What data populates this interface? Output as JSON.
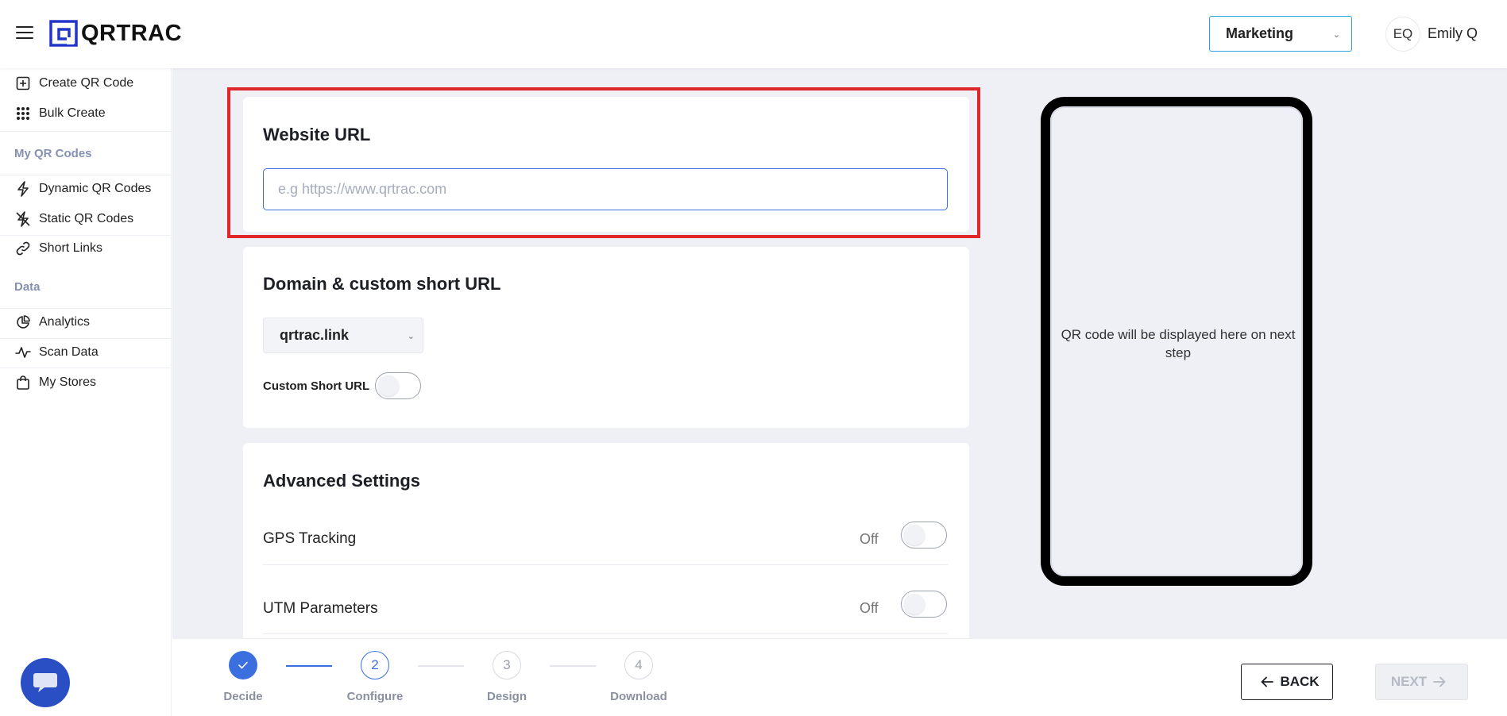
{
  "header": {
    "logo_text": "QRTRAC",
    "org_select": "Marketing",
    "avatar_initials": "EQ",
    "user_name": "Emily Q"
  },
  "sidebar": {
    "create_qr": "Create QR Code",
    "bulk_create": "Bulk Create",
    "section_my_qr": "My QR Codes",
    "dynamic_qr": "Dynamic QR Codes",
    "static_qr": "Static QR Codes",
    "short_links": "Short Links",
    "section_data": "Data",
    "analytics": "Analytics",
    "scan_data": "Scan Data",
    "my_stores": "My Stores"
  },
  "website_url": {
    "title": "Website URL",
    "placeholder": "e.g https://www.qrtrac.com",
    "value": ""
  },
  "domain": {
    "title": "Domain & custom short URL",
    "selected": "qrtrac.link",
    "custom_short_url_label": "Custom Short URL"
  },
  "advanced": {
    "title": "Advanced Settings",
    "gps_label": "GPS Tracking",
    "gps_state": "Off",
    "utm_label": "UTM Parameters",
    "utm_state": "Off"
  },
  "preview": {
    "text": "QR code will be displayed here on next step"
  },
  "stepper": {
    "steps": [
      {
        "number": "1",
        "label": "Decide",
        "status": "done"
      },
      {
        "number": "2",
        "label": "Configure",
        "status": "active"
      },
      {
        "number": "3",
        "label": "Design",
        "status": "todo"
      },
      {
        "number": "4",
        "label": "Download",
        "status": "todo"
      }
    ],
    "back_label": "BACK",
    "next_label": "NEXT"
  },
  "colors": {
    "accent": "#3b6fe0",
    "highlight": "#e0262b",
    "chat_fab": "#2a4fc4"
  }
}
